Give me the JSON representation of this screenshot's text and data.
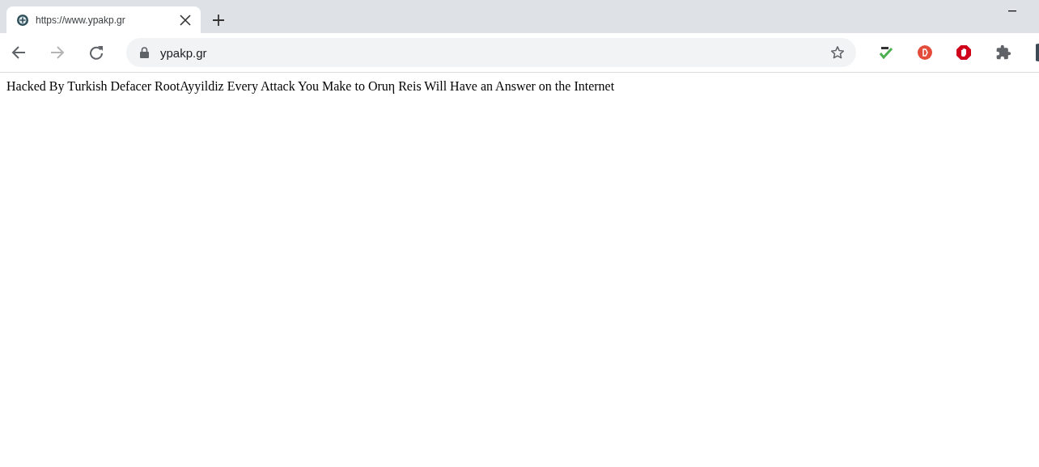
{
  "tabs": [
    {
      "title": "https://www.ypakp.gr",
      "selected": true
    }
  ],
  "nav": [
    {
      "kind": "back",
      "disabled": false
    },
    {
      "kind": "forward",
      "disabled": true
    },
    {
      "kind": "reload",
      "disabled": false
    }
  ],
  "address": {
    "value": "ypakp.gr",
    "secure": true
  },
  "extensions": [
    {
      "kind": "spell"
    },
    {
      "kind": "red-circle"
    },
    {
      "kind": "hand"
    },
    {
      "kind": "puzzle"
    },
    {
      "kind": "avatar"
    }
  ],
  "page": {
    "text": "Hacked By Turkish Defacer RootAyyildiz Every Attack You Make to Oruη Reis Will Have an Answer on the Internet"
  }
}
